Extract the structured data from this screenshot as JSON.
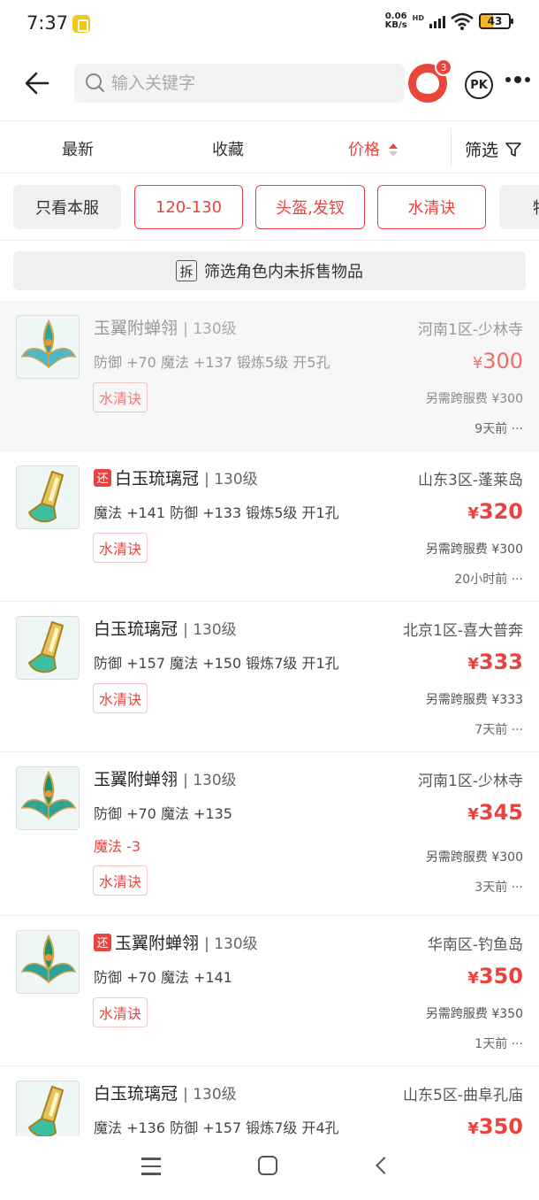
{
  "status_bar": {
    "time": "7:37",
    "net_speed_value": "0.06",
    "net_speed_unit": "KB/s",
    "net_type": "HD",
    "battery": "43"
  },
  "header": {
    "search_placeholder": "输入关键字",
    "avatar_badge": "3",
    "pk_label": "PK"
  },
  "sort_tabs": {
    "latest": "最新",
    "favorites": "收藏",
    "price": "价格",
    "filter": "筛选"
  },
  "chips": [
    {
      "label": "只看本服"
    },
    {
      "label": "120-130"
    },
    {
      "label": "头盔,发钗"
    },
    {
      "label": "水清诀"
    },
    {
      "label": "特"
    }
  ],
  "unsplit_filter": {
    "icon_char": "拆",
    "label": "筛选角色内未拆售物品"
  },
  "listings": [
    {
      "name": "玉翼附蝉翎",
      "level": "130级",
      "attrs": "防御 +70 魔法 +137 锻炼5级 开5孔",
      "tag": "水清诀",
      "server": "河南1区-少林寺",
      "price": "300",
      "fee": "另需跨服费 ¥300",
      "ago": "9天前 ···"
    },
    {
      "return_mark": "还",
      "name": "白玉琉璃冠",
      "level": "130级",
      "attrs": "魔法 +141 防御 +133 锻炼5级 开1孔",
      "tag": "水清诀",
      "server": "山东3区-蓬莱岛",
      "price": "320",
      "fee": "另需跨服费 ¥300",
      "ago": "20小时前 ···"
    },
    {
      "name": "白玉琉璃冠",
      "level": "130级",
      "attrs": "防御 +157 魔法 +150 锻炼7级 开1孔",
      "tag": "水清诀",
      "server": "北京1区-喜大普奔",
      "price": "333",
      "fee": "另需跨服费 ¥333",
      "ago": "7天前 ···"
    },
    {
      "name": "玉翼附蝉翎",
      "level": "130级",
      "attrs": "防御 +70 魔法 +135",
      "negative": "魔法 -3",
      "tag": "水清诀",
      "server": "河南1区-少林寺",
      "price": "345",
      "fee": "另需跨服费 ¥300",
      "ago": "3天前 ···"
    },
    {
      "return_mark": "还",
      "name": "玉翼附蝉翎",
      "level": "130级",
      "attrs": "防御 +70 魔法 +141",
      "tag": "水清诀",
      "server": "华南区-钓鱼岛",
      "price": "350",
      "fee": "另需跨服费 ¥350",
      "ago": "1天前 ···"
    },
    {
      "name": "白玉琉璃冠",
      "level": "130级",
      "attrs": "魔法 +136 防御 +157 锻炼7级 开4孔",
      "server": "山东5区-曲阜孔庙",
      "price": "350"
    }
  ],
  "currency_symbol": "¥",
  "colors": {
    "accent": "#e9433f",
    "chip_grey": "#f0f0f0",
    "text_dark": "#222222"
  }
}
